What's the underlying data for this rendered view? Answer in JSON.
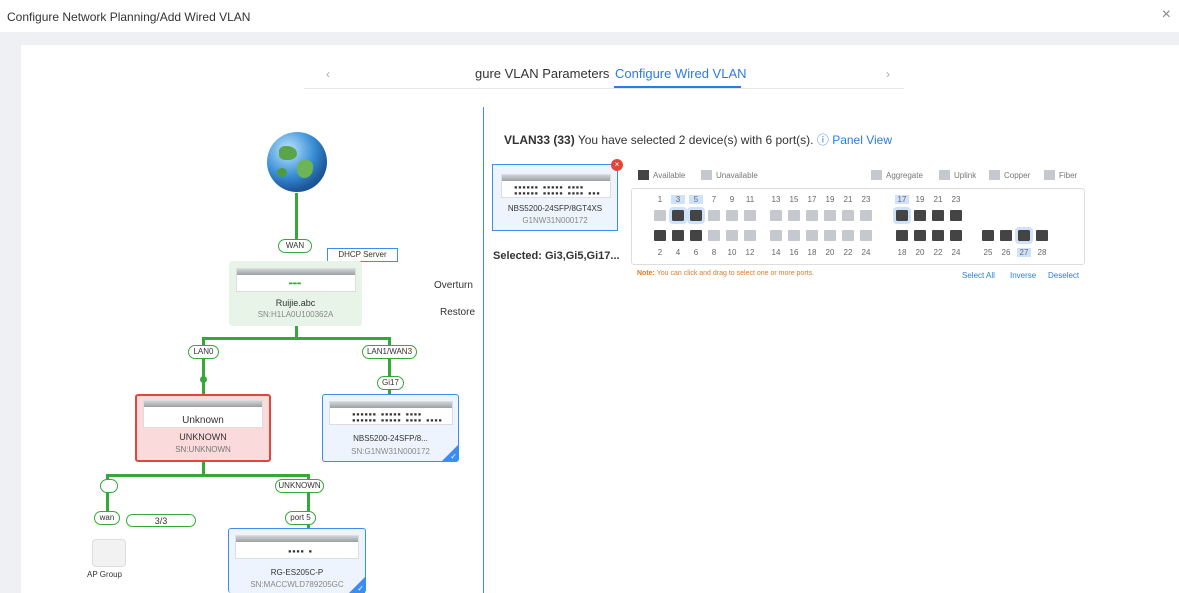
{
  "header": {
    "title": "Configure Network Planning/Add Wired VLAN",
    "close": "×"
  },
  "steps": {
    "prev": "‹",
    "next": "›",
    "step1": "gure VLAN Parameters",
    "step2": "Configure Wired VLAN"
  },
  "topology": {
    "wan_label": "WAN",
    "dhcp_label": "DHCP Server",
    "gateway": {
      "name": "Ruijie.abc",
      "sn": "SN:H1LA0U100362A"
    },
    "lan0": "LAN0",
    "lan1": "LAN1/WAN3",
    "gi17": "Gi17",
    "unknown": {
      "display": "Unknown",
      "name": "UNKNOWN",
      "sn": "SN:UNKNOWN"
    },
    "switch1": {
      "name": "NBS5200-24SFP/8...",
      "sn": "SN:G1NW31N000172"
    },
    "unknown_port": "UNKNOWN",
    "wan_port": "wan",
    "ap_count": "3/3",
    "ap_group": "AP Group",
    "port5": "port 5",
    "switch2": {
      "name": "RG-ES205C-P",
      "sn": "SN:MACCWLD789205GC"
    }
  },
  "side_buttons": {
    "overturn": "Overturn",
    "restore": "Restore"
  },
  "right": {
    "vlan": "VLAN33 (33)",
    "summary": "You have selected 2 device(s) with 6 port(s).",
    "panel_view": "Panel View",
    "device": {
      "name": "NBS5200-24SFP/8GT4XS",
      "sn": "G1NW31N000172"
    },
    "selected": "Selected: Gi3,Gi5,Gi17...",
    "legend": {
      "available": "Available",
      "unavailable": "Unavailable",
      "aggregate": "Aggregate",
      "uplink": "Uplink",
      "copper": "Copper",
      "fiber": "Fiber"
    },
    "note_label": "Note:",
    "note": "You can click and drag to select one or more ports.",
    "select_all": "Select All",
    "inverse": "Inverse",
    "deselect": "Deselect",
    "top_numbers": [
      "1",
      "3",
      "5",
      "7",
      "9",
      "11",
      "13",
      "15",
      "17",
      "19",
      "21",
      "23",
      "17",
      "19",
      "21",
      "23"
    ],
    "bottom_numbers": [
      "2",
      "4",
      "6",
      "8",
      "10",
      "12",
      "14",
      "16",
      "18",
      "20",
      "22",
      "24",
      "18",
      "20",
      "22",
      "24",
      "25",
      "26",
      "27",
      "28"
    ]
  },
  "colors": {
    "accent": "#2b7be4",
    "link_green": "#36a83a",
    "error": "#e0463c"
  }
}
